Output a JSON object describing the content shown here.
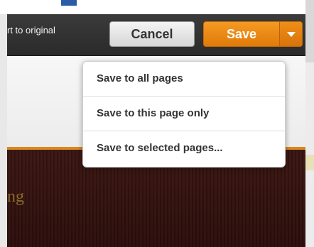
{
  "toolbar": {
    "revert_label": "rt to original",
    "cancel_label": "Cancel",
    "save_label": "Save",
    "dropdown_icon": "chevron-down-icon"
  },
  "save_menu": {
    "items": [
      {
        "label": "Save to all pages"
      },
      {
        "label": "Save to this page only"
      },
      {
        "label": "Save to selected pages..."
      }
    ]
  },
  "page": {
    "heading_fragment": "ng"
  },
  "colors": {
    "toolbar_bg": "#2f2f2f",
    "save_accent": "#f08c14",
    "page_dark": "#331310",
    "page_accent_line": "#d9871e"
  }
}
